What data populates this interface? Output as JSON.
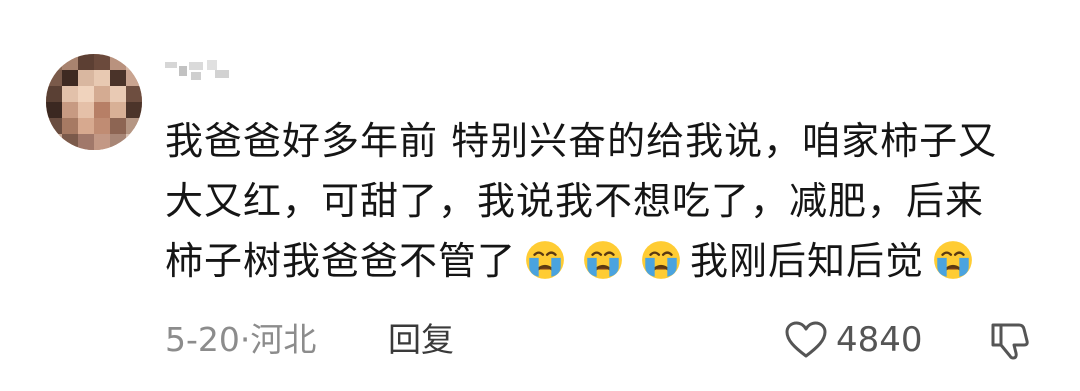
{
  "comment": {
    "body": {
      "line1": "我爸爸好多年前 特别兴奋的给我说，咱家柿子又",
      "line2": "大又红，可甜了，我说我不想吃了，减肥，后来",
      "line3_part1": "柿子树我爸爸不管了",
      "line3_part2": "我刚后知后觉"
    },
    "date": "5-20",
    "separator": "·",
    "location": "河北",
    "reply_label": "回复",
    "like_count": "4840"
  },
  "icons": {
    "emoji": "loudly-crying-face-icon",
    "like": "heart-outline-icon",
    "dislike": "thumbs-down-outline-icon"
  },
  "colors": {
    "text": "#151515",
    "meta": "#8c8c8c",
    "emoji_face": "#ffcc33",
    "emoji_tears": "#4aa3df"
  }
}
